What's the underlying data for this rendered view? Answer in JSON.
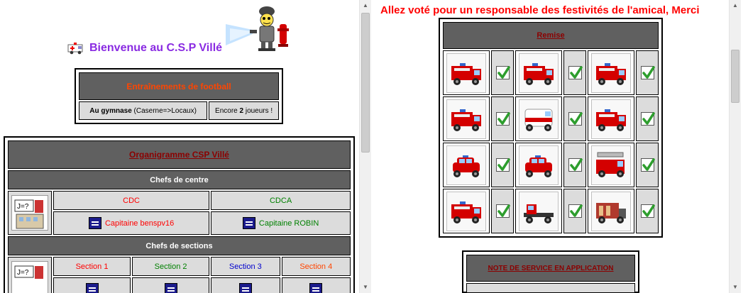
{
  "left": {
    "welcome_text": "Bienvenue au C.S.P Villé",
    "football": {
      "title": "Entraînements de football",
      "location_bold": "Au gymnase",
      "location_rest": " (Caserne=>Locaux)",
      "players_prefix": "Encore ",
      "players_count": "2",
      "players_suffix": " joueurs !"
    },
    "organigram": {
      "title": "Organigramme CSP Villé",
      "chefs_centre": "Chefs de centre",
      "roles": [
        {
          "label": "CDC",
          "color": "#ff0000"
        },
        {
          "label": "CDCA",
          "color": "#008000"
        }
      ],
      "names": [
        {
          "label": "Capitaine benspv16",
          "color": "#ff0000"
        },
        {
          "label": "Capitaine ROBIN",
          "color": "#008000"
        }
      ],
      "chefs_sections": "Chefs de sections",
      "sections": [
        {
          "label": "Section 1",
          "color": "#ff0000"
        },
        {
          "label": "Section 2",
          "color": "#008000"
        },
        {
          "label": "Section 3",
          "color": "#0000cd"
        },
        {
          "label": "Section 4",
          "color": "#ff4500"
        }
      ]
    }
  },
  "right": {
    "banner": "Allez voté pour un responsable des festivités de l'amical, Merci",
    "remise_title": "Remise",
    "vehicles": [
      [
        "fire-truck-icon",
        "fire-truck-icon",
        "fire-truck-icon"
      ],
      [
        "fire-truck-icon",
        "fire-van-icon",
        "fire-truck-icon"
      ],
      [
        "fire-4x4-icon",
        "fire-car-icon",
        "ladder-truck-icon"
      ],
      [
        "fire-truck-icon",
        "tractor-unit-icon",
        "container-truck-icon"
      ]
    ],
    "note_title": "NOTE DE SERVICE EN APPLICATION"
  },
  "colors": {
    "header_gray": "#606060",
    "cell_gray": "#dcdcdc",
    "truck_red": "#d40000"
  }
}
